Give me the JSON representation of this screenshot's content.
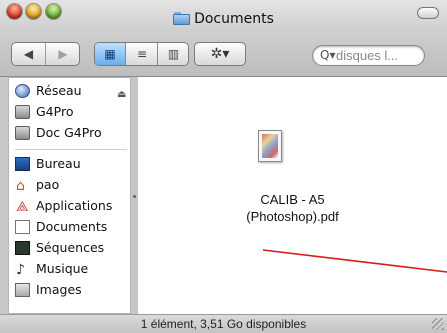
{
  "window": {
    "title": "Documents"
  },
  "toolbar": {
    "back_glyph": "◀",
    "forward_glyph": "▶",
    "view_icon_glyph": "▦",
    "view_list_glyph": "≡",
    "view_column_glyph": "▥",
    "action_glyph": "✲▾"
  },
  "search": {
    "glyph": "Q▾",
    "placeholder": "disques l..."
  },
  "sidebar": {
    "items": [
      {
        "label": "Réseau",
        "icon": "network-globe-icon"
      },
      {
        "label": "G4Pro",
        "icon": "hard-disk-icon"
      },
      {
        "label": "Doc G4Pro",
        "icon": "hard-disk-icon"
      },
      {
        "label": "Bureau",
        "icon": "desktop-icon"
      },
      {
        "label": "pao",
        "icon": "home-icon"
      },
      {
        "label": "Applications",
        "icon": "applications-icon"
      },
      {
        "label": "Documents",
        "icon": "documents-icon"
      },
      {
        "label": "Séquences",
        "icon": "movies-icon"
      },
      {
        "label": "Musique",
        "icon": "music-icon"
      },
      {
        "label": "Images",
        "icon": "pictures-icon"
      }
    ],
    "eject_glyph": "⏏"
  },
  "content": {
    "file": {
      "name_line1": "CALIB - A5",
      "name_line2": "(Photoshop).pdf",
      "icon": "pdf-file-icon"
    }
  },
  "status": {
    "text": "1 élément, 3,51 Go disponibles"
  },
  "colors": {
    "annotation_line": "#d81a1a",
    "selected_view": "#6aaee8"
  }
}
